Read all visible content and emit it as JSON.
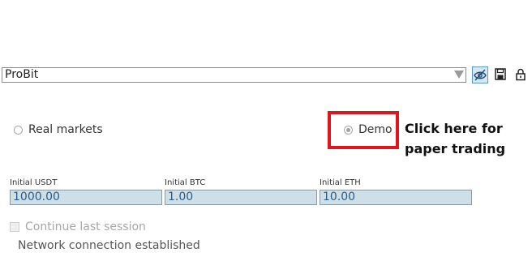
{
  "exchange_select": {
    "value": "ProBit"
  },
  "toolbar": {
    "visibility_icon": "eye-slash-icon",
    "save_icon": "floppy-disk-icon",
    "lock_icon": "lock-icon"
  },
  "mode": {
    "real_label": "Real markets",
    "demo_label": "Demo",
    "selected": "Demo"
  },
  "annotation": {
    "callout_text": "Click here for paper trading",
    "highlight_color": "#e0161e"
  },
  "initial_balances": [
    {
      "label": "Initial USDT",
      "value": "1000.00"
    },
    {
      "label": "Initial BTC",
      "value": "1.00"
    },
    {
      "label": "Initial ETH",
      "value": "10.00"
    }
  ],
  "continue_session": {
    "label": "Continue last session",
    "checked": false,
    "enabled": false
  },
  "status_text": "Network connection established"
}
